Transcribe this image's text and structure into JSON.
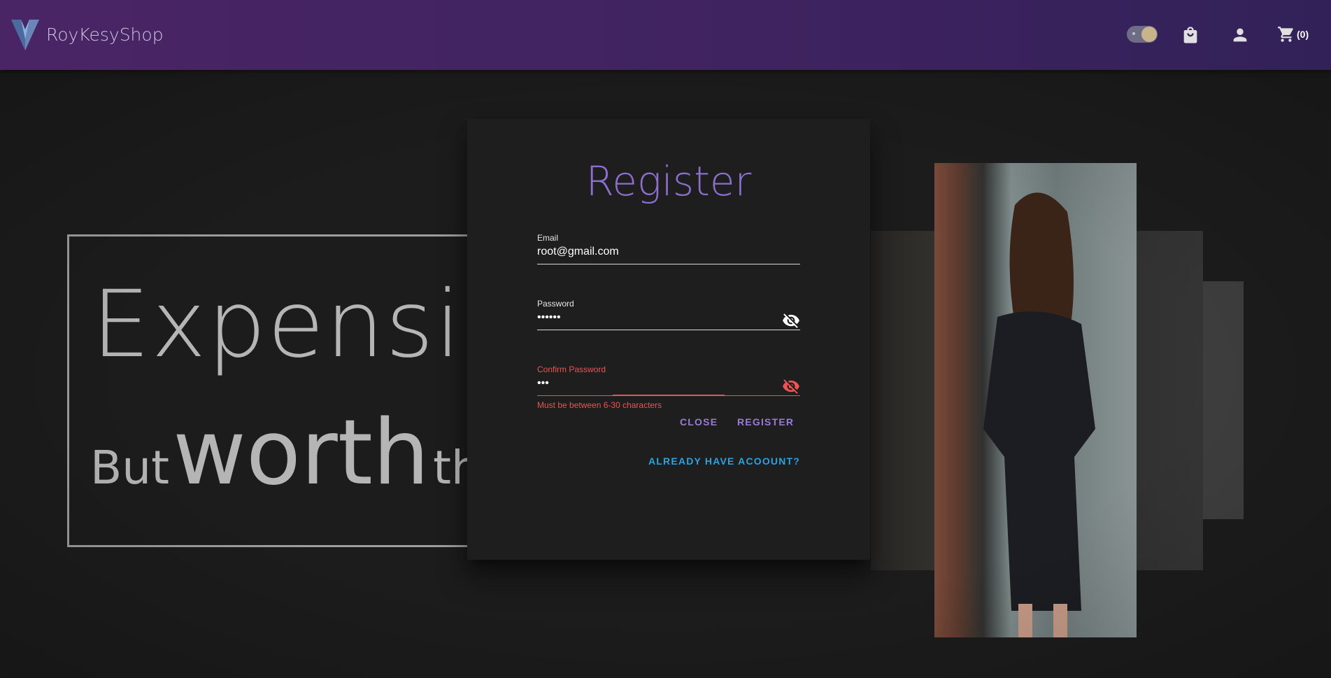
{
  "app": {
    "brand_name": "RoyKesyShop",
    "cart_count": "(0)",
    "colors": {
      "appbar_start": "#4a2566",
      "appbar_end": "#322159",
      "accent": "#8a6fcd",
      "link": "#2ba3e0",
      "error": "#ef5350"
    }
  },
  "hero": {
    "line1": "Expensive",
    "line2_prefix": "But",
    "line2_big": "worth",
    "line2_suffix": "the"
  },
  "register_dialog": {
    "title": "Register",
    "email": {
      "label": "Email",
      "value": "root@gmail.com"
    },
    "password": {
      "label": "Password",
      "value": "••••••",
      "toggle_icon": "eye-off-icon"
    },
    "confirm_password": {
      "label": "Confirm Password",
      "value": "•••",
      "toggle_icon": "eye-off-icon",
      "error": "Must be between 6-30 characters"
    },
    "close_label": "Close",
    "register_label": "Register",
    "login_link_label": "Already have acoount?"
  }
}
